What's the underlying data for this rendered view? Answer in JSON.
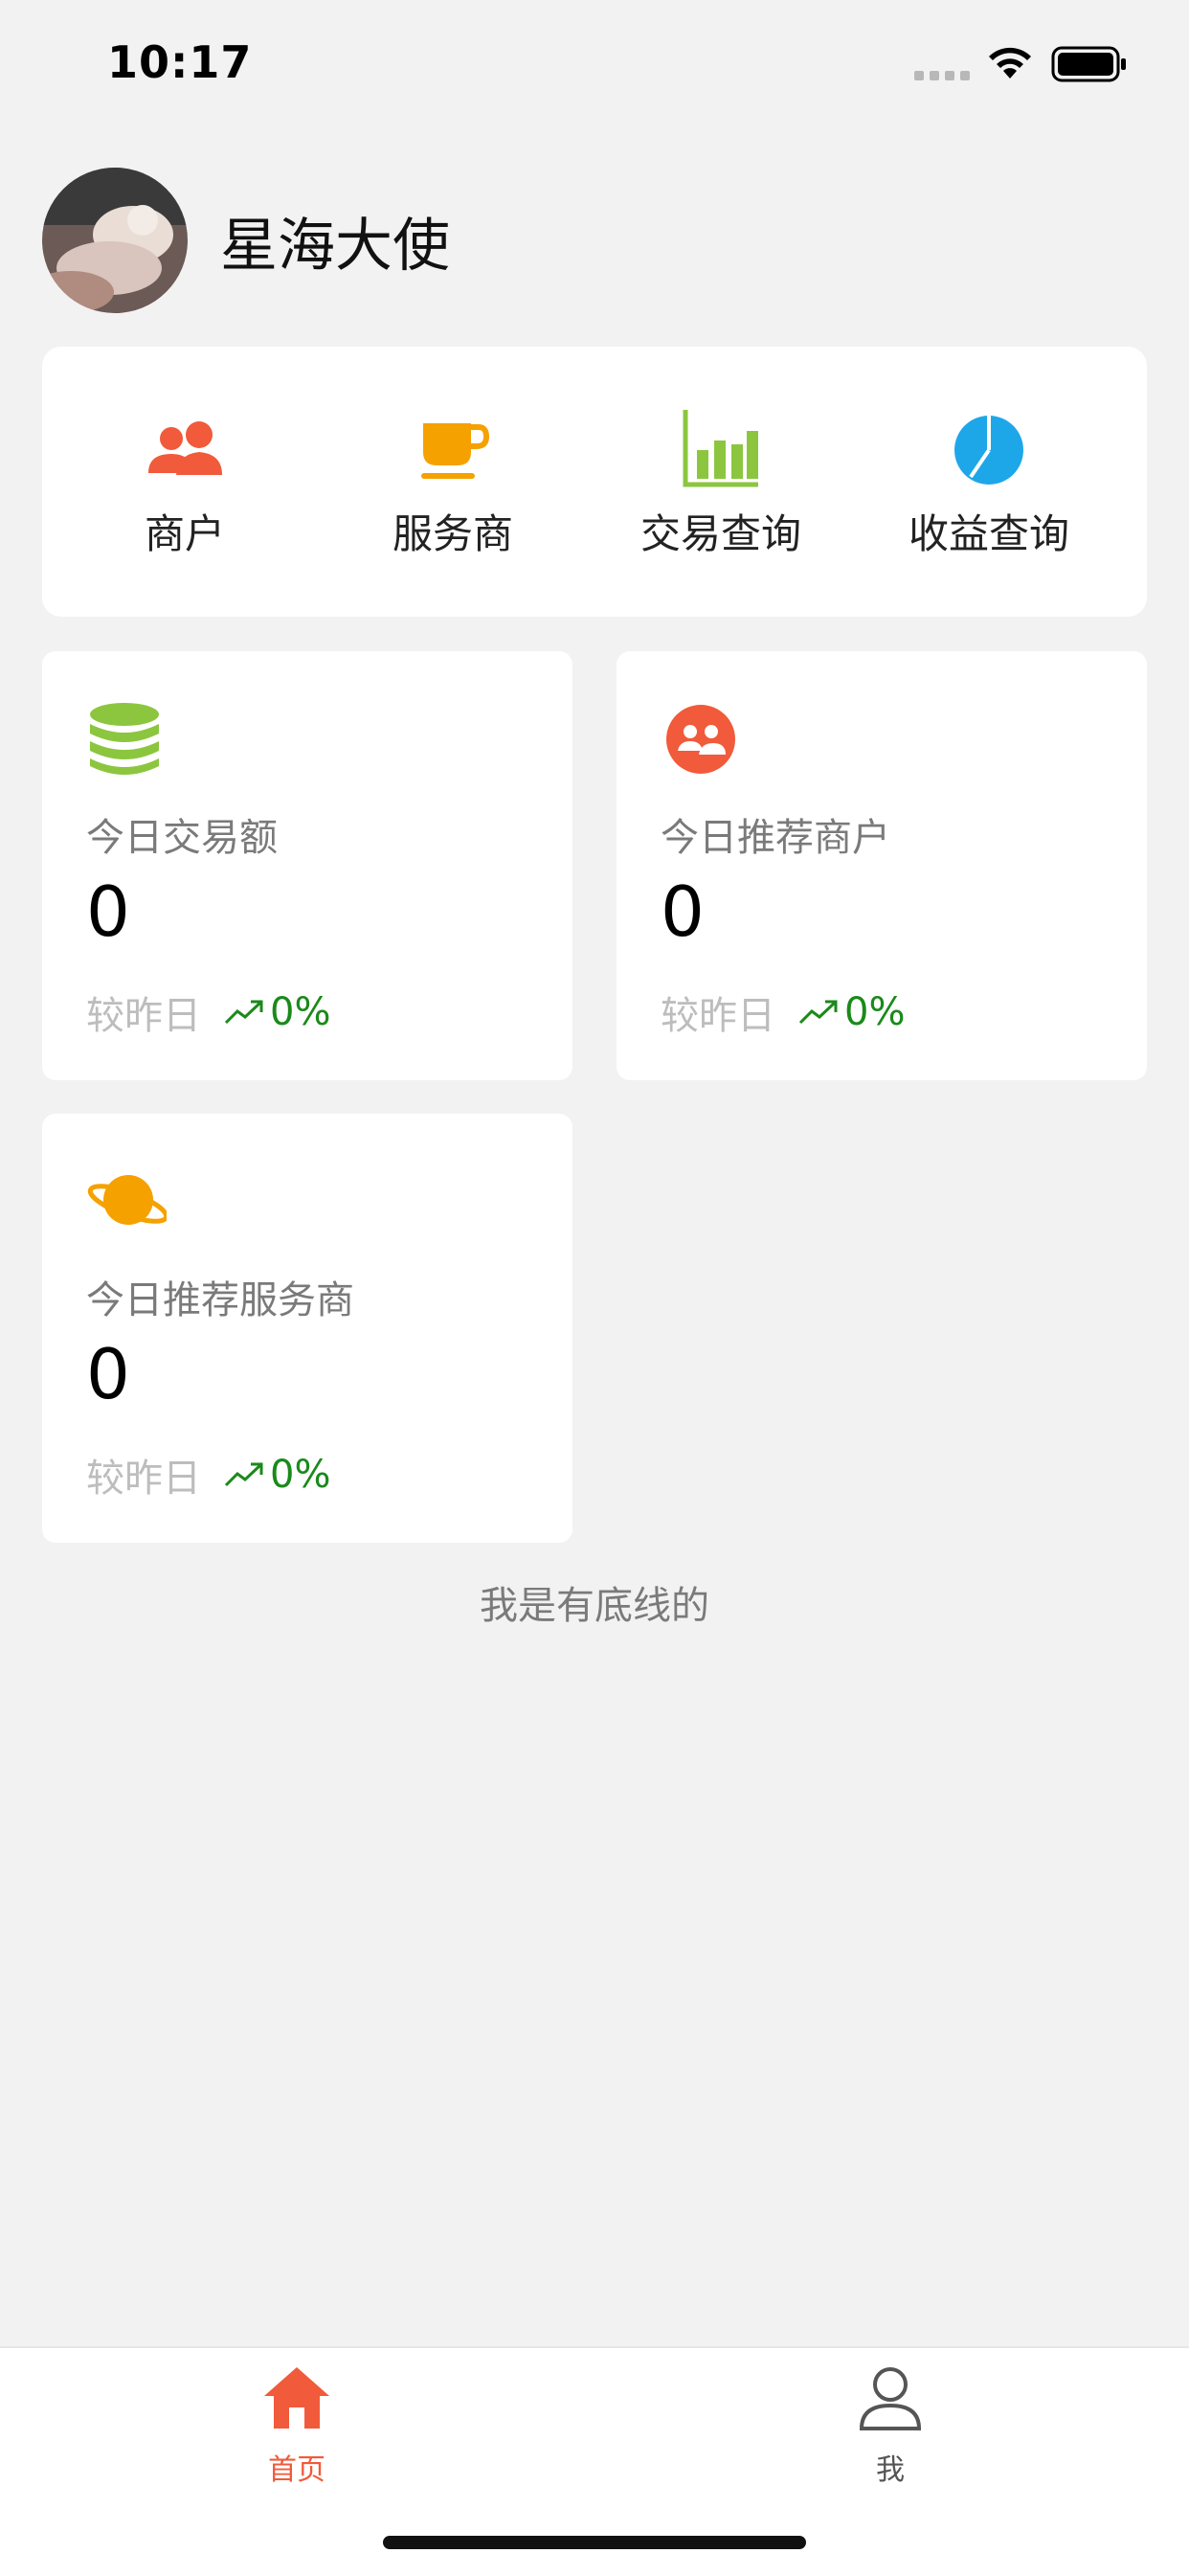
{
  "status_bar": {
    "time": "10:17"
  },
  "profile": {
    "name": "星海大使",
    "avatar_icon": "avatar-photo"
  },
  "menu": {
    "items": [
      {
        "label": "商户",
        "icon": "users-icon",
        "color": "#f15a3a"
      },
      {
        "label": "服务商",
        "icon": "cup-icon",
        "color": "#f5a100"
      },
      {
        "label": "交易查询",
        "icon": "bar-chart-icon",
        "color": "#8cc63f"
      },
      {
        "label": "收益查询",
        "icon": "pie-chart-icon",
        "color": "#1ea7e8"
      }
    ]
  },
  "stats": [
    {
      "label": "今日交易额",
      "value": "0",
      "compare_label": "较昨日",
      "change": "0%",
      "icon": "database-icon",
      "color": "#8cc63f"
    },
    {
      "label": "今日推荐商户",
      "value": "0",
      "compare_label": "较昨日",
      "change": "0%",
      "icon": "group-icon",
      "color": "#f15a3a"
    },
    {
      "label": "今日推荐服务商",
      "value": "0",
      "compare_label": "较昨日",
      "change": "0%",
      "icon": "planet-icon",
      "color": "#f5a100"
    }
  ],
  "footer_note": "我是有底线的",
  "tab_bar": {
    "tabs": [
      {
        "label": "首页",
        "icon": "home-icon",
        "active": true
      },
      {
        "label": "我",
        "icon": "person-icon",
        "active": false
      }
    ]
  },
  "colors": {
    "accent": "#f15a3a",
    "trend_up": "#1a8a1a",
    "background": "#f2f2f2"
  }
}
